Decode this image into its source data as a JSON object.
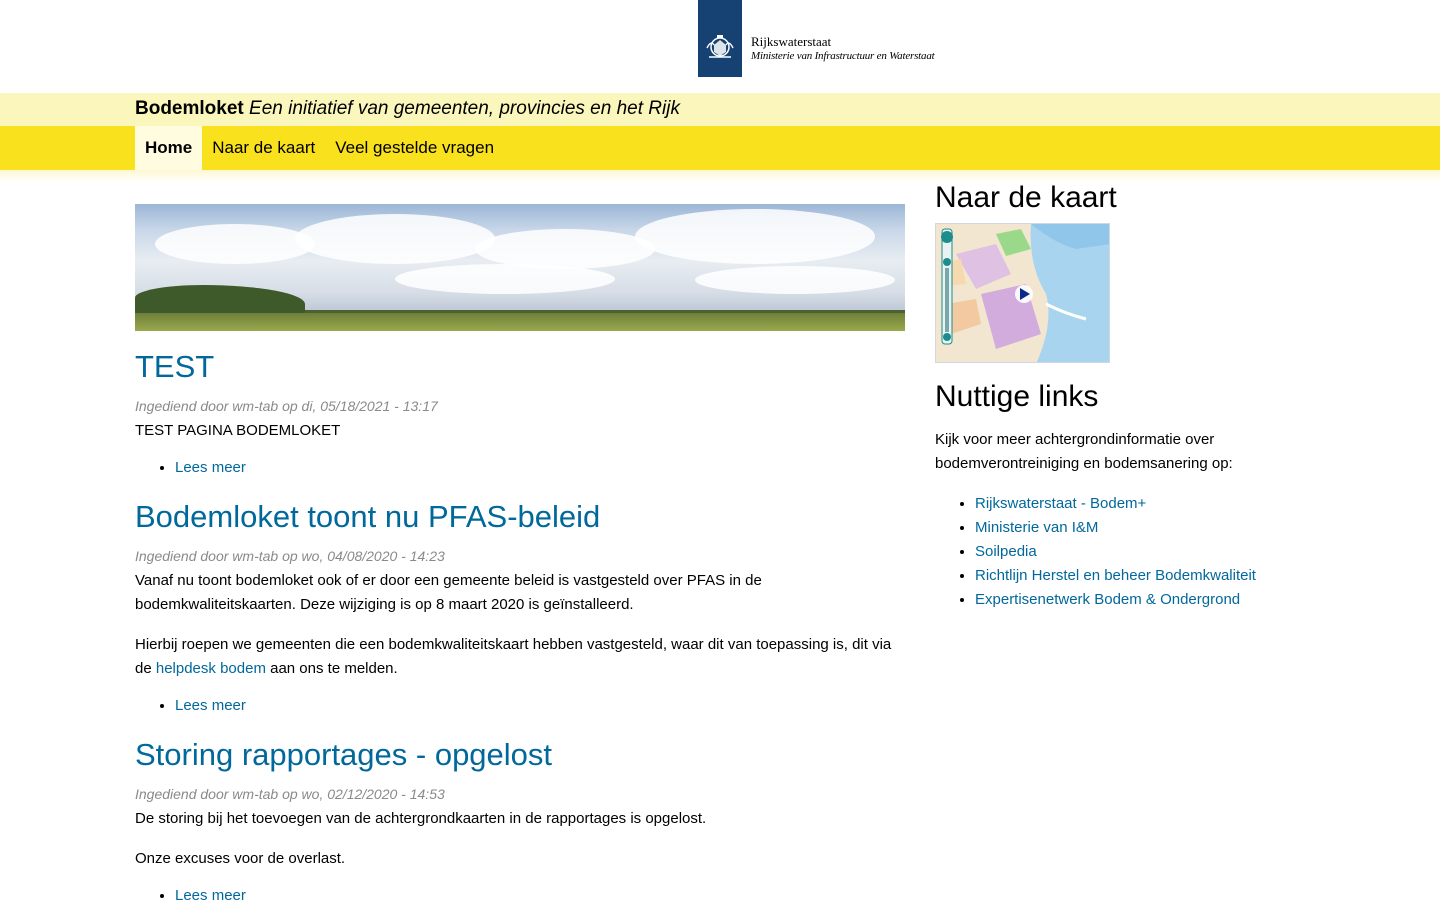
{
  "header": {
    "org_name": "Rijkswaterstaat",
    "org_sub": "Ministerie van Infrastructuur en Waterstaat"
  },
  "site": {
    "name": "Bodemloket",
    "tagline": "Een initiatief van gemeenten, provincies en het Rijk"
  },
  "nav": {
    "items": [
      {
        "label": "Home",
        "active": true
      },
      {
        "label": "Naar de kaart",
        "active": false
      },
      {
        "label": "Veel gestelde vragen",
        "active": false
      }
    ]
  },
  "articles": [
    {
      "title": "TEST",
      "meta": "Ingediend door wm-tab op di, 05/18/2021 - 13:17",
      "body": [
        "TEST PAGINA BODEMLOKET"
      ],
      "read_more": "Lees meer"
    },
    {
      "title": "Bodemloket toont nu PFAS-beleid",
      "meta": "Ingediend door wm-tab op wo, 04/08/2020 - 14:23",
      "body": [
        "Vanaf nu toont bodemloket ook of er door een gemeente beleid is vastgesteld over PFAS in de bodemkwaliteitskaarten. Deze wijziging is op 8 maart 2020 is geïnstalleerd."
      ],
      "body2_before": "Hierbij roepen we gemeenten die een bodemkwaliteitskaart hebben vastgesteld, waar dit van toepassing is, dit via de ",
      "body2_link": "helpdesk bodem",
      "body2_after": " aan ons te melden.",
      "read_more": "Lees meer"
    },
    {
      "title": "Storing rapportages - opgelost",
      "meta": "Ingediend door wm-tab op wo, 02/12/2020 - 14:53",
      "body": [
        "De storing bij het toevoegen van de achtergrondkaarten in de rapportages is opgelost.",
        "Onze excuses voor de overlast."
      ],
      "read_more": "Lees meer"
    }
  ],
  "sidebar": {
    "map_heading": "Naar de kaart",
    "links_heading": "Nuttige links",
    "links_intro": "Kijk voor meer achtergrondinformatie over bodemverontreiniging en bodemsanering op:",
    "links": [
      "Rijkswaterstaat - Bodem+",
      "Ministerie van I&M",
      "Soilpedia",
      "Richtlijn Herstel en beheer Bodemkwaliteit",
      "Expertisenetwerk Bodem & Ondergrond"
    ]
  },
  "colors": {
    "brand_blue": "#154273",
    "link": "#01689b",
    "nav_yellow": "#f9e11e",
    "title_bar": "#fbf6bb"
  }
}
